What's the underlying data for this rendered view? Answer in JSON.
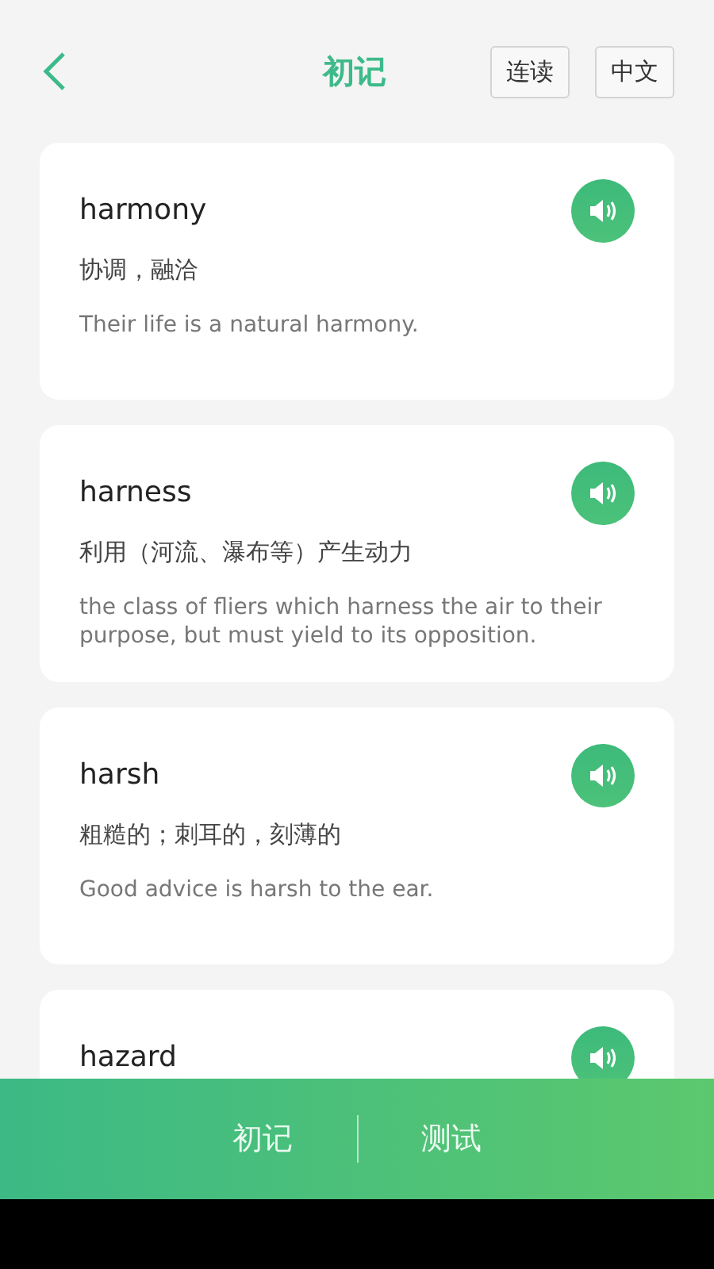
{
  "header": {
    "title": "初记",
    "buttons": [
      "连读",
      "中文"
    ]
  },
  "words": [
    {
      "word": "harmony",
      "meaning": "协调，融洽",
      "example": "Their life is a natural harmony."
    },
    {
      "word": "harness",
      "meaning": "利用（河流、瀑布等）产生动力",
      "example": "the class of fliers which harness the air to their purpose, but must yield to its opposition."
    },
    {
      "word": "harsh",
      "meaning": "粗糙的；刺耳的，刻薄的",
      "example": "Good advice is harsh to the ear."
    },
    {
      "word": "hazard"
    }
  ],
  "bottom_tabs": [
    "初记",
    "测试"
  ]
}
